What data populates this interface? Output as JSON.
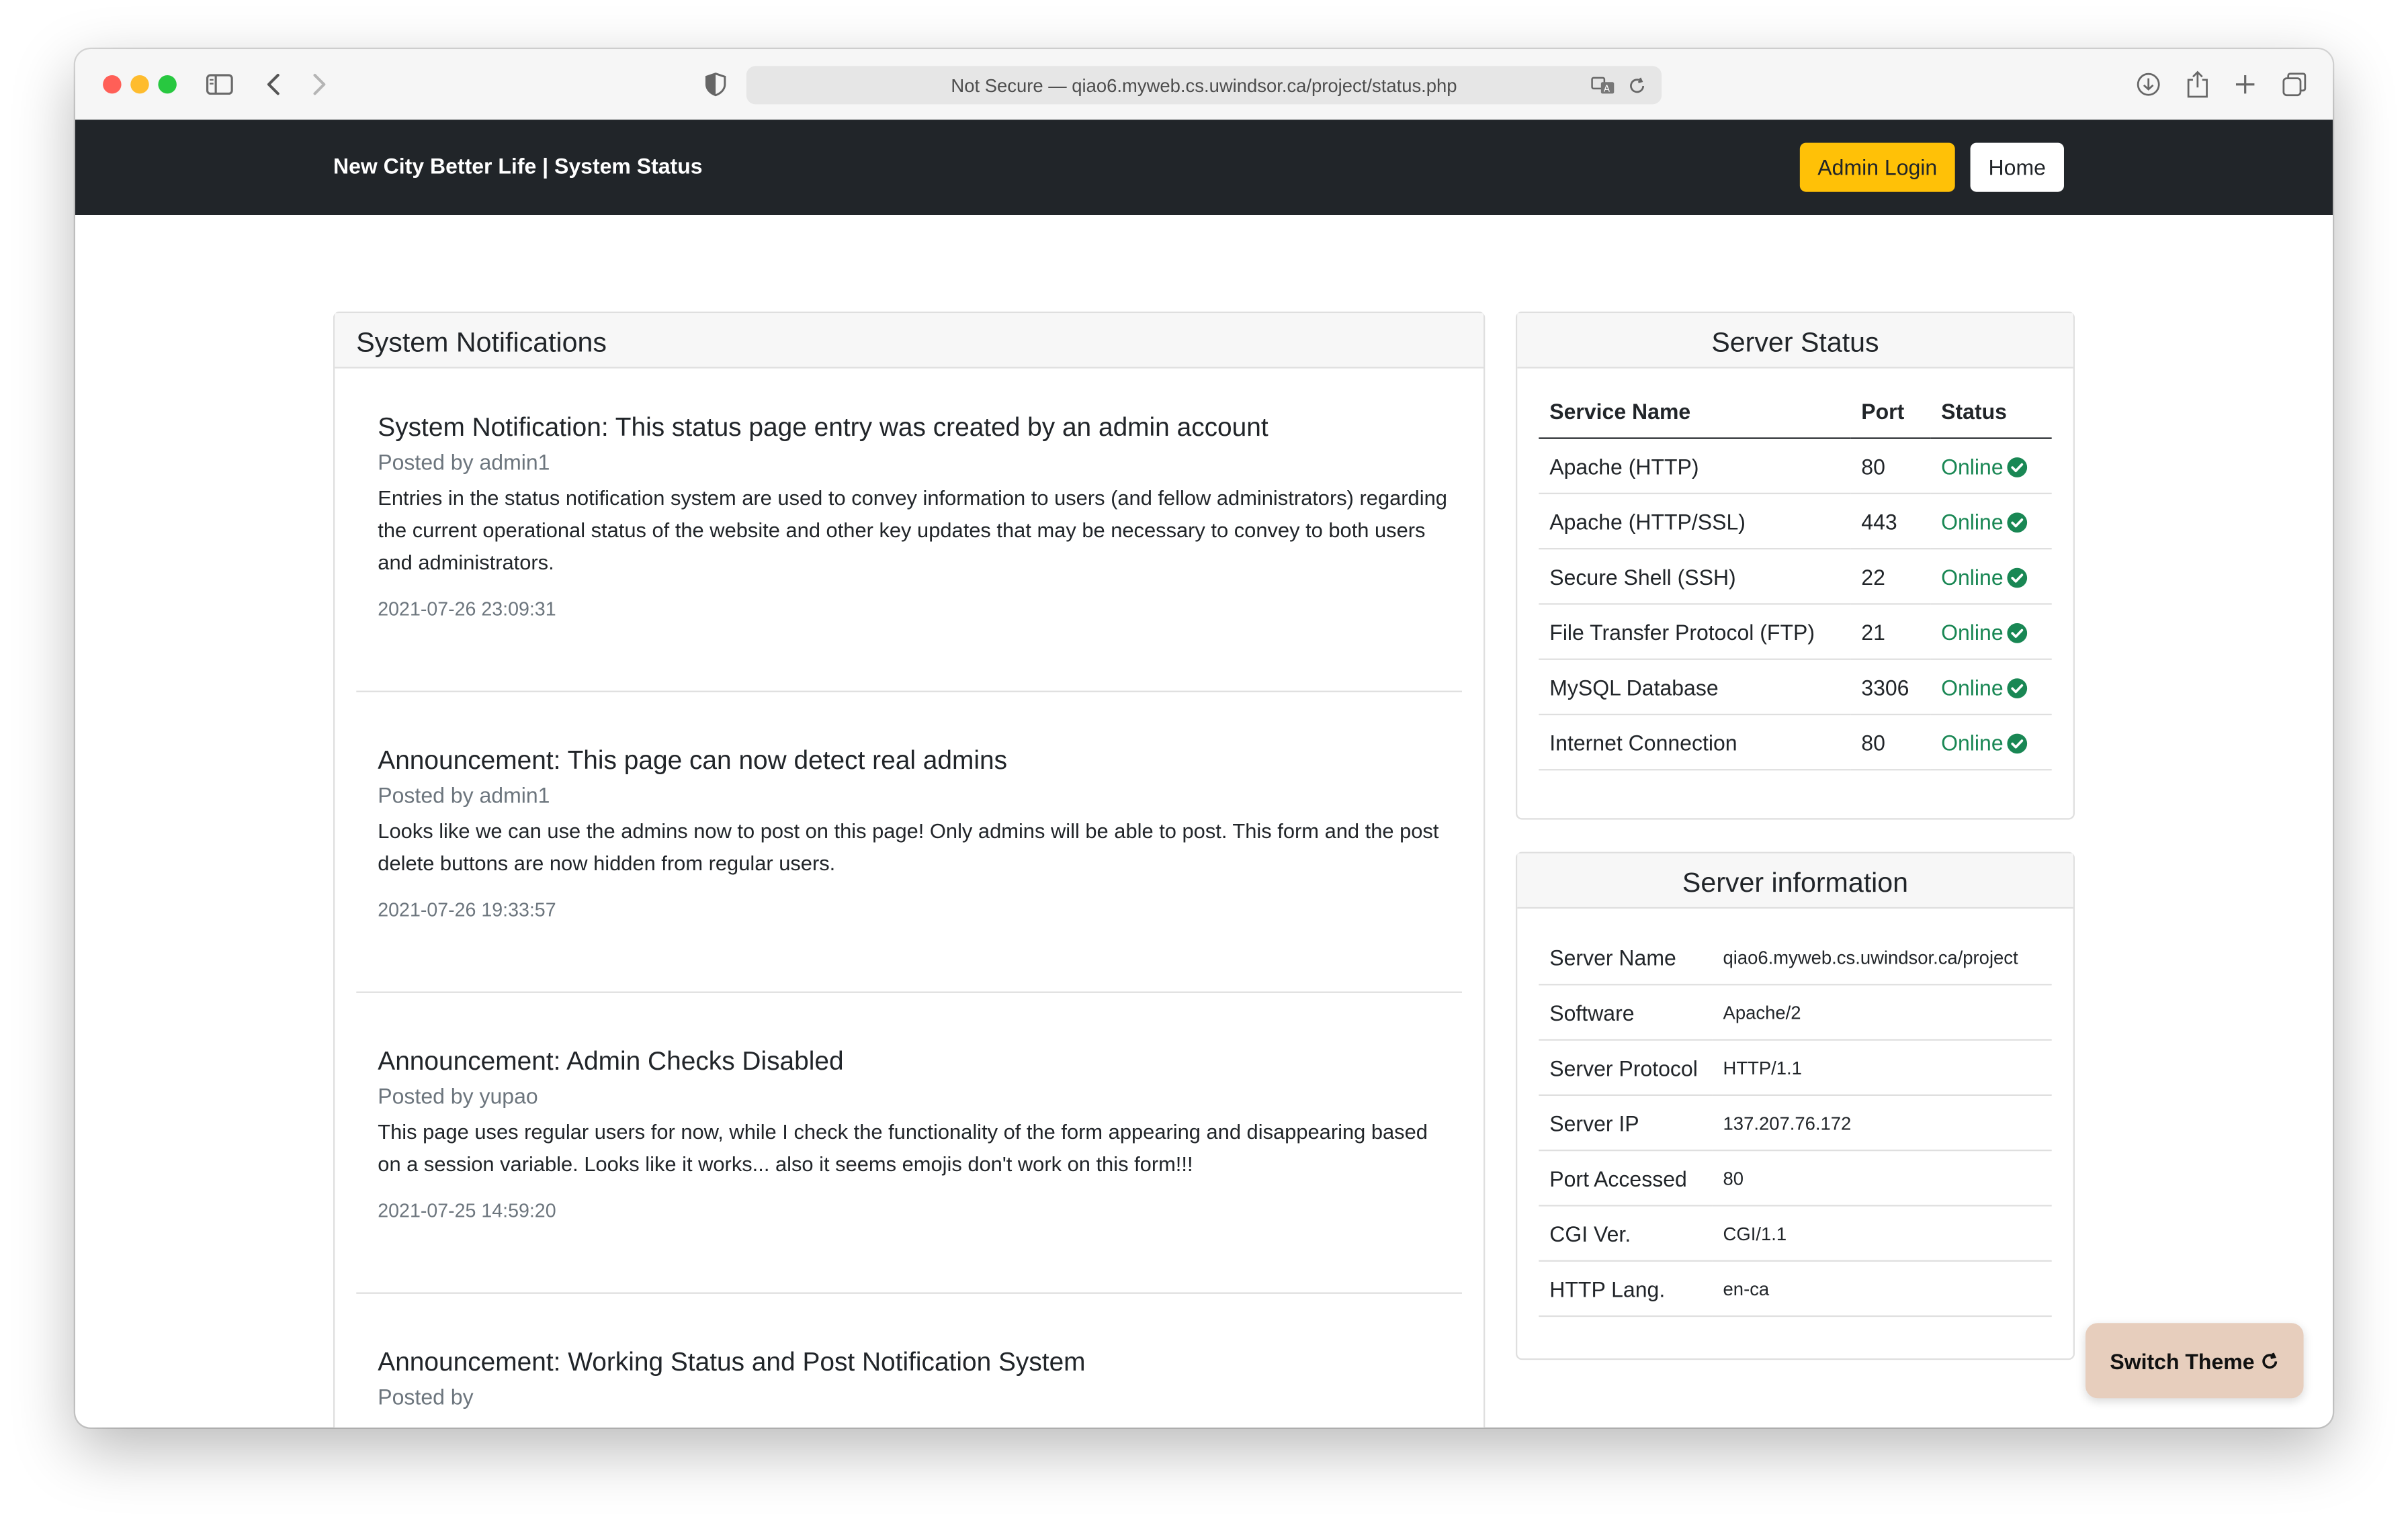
{
  "browser": {
    "address": "Not Secure — qiao6.myweb.cs.uwindsor.ca/project/status.php",
    "traffic_colors": [
      "#ff5f57",
      "#febc2e",
      "#28c840"
    ]
  },
  "navbar": {
    "brand": "New City Better Life | System Status",
    "admin_login": "Admin Login",
    "home": "Home"
  },
  "notifications": {
    "heading": "System Notifications",
    "posts": [
      {
        "title": "System Notification: This status page entry was created by an admin account",
        "posted_by": "Posted by admin1",
        "body": "Entries in the status notification system are used to convey information to users (and fellow administrators) regarding the current operational status of the website and other key updates that may be necessary to convey to both users and administrators.",
        "date": "2021-07-26 23:09:31"
      },
      {
        "title": "Announcement: This page can now detect real admins",
        "posted_by": "Posted by admin1",
        "body": "Looks like we can use the admins now to post on this page! Only admins will be able to post. This form and the post delete buttons are now hidden from regular users.",
        "date": "2021-07-26 19:33:57"
      },
      {
        "title": "Announcement: Admin Checks Disabled",
        "posted_by": "Posted by yupao",
        "body": "This page uses regular users for now, while I check the functionality of the form appearing and disappearing based on a session variable. Looks like it works... also it seems emojis don't work on this form!!!",
        "date": "2021-07-25 14:59:20"
      },
      {
        "title": "Announcement: Working Status and Post Notification System",
        "posted_by": "Posted by"
      }
    ]
  },
  "server_status": {
    "heading": "Server Status",
    "columns": [
      "Service Name",
      "Port",
      "Status"
    ],
    "rows": [
      {
        "service": "Apache (HTTP)",
        "port": "80",
        "status": "Online"
      },
      {
        "service": "Apache (HTTP/SSL)",
        "port": "443",
        "status": "Online"
      },
      {
        "service": "Secure Shell (SSH)",
        "port": "22",
        "status": "Online"
      },
      {
        "service": "File Transfer Protocol (FTP)",
        "port": "21",
        "status": "Online"
      },
      {
        "service": "MySQL Database",
        "port": "3306",
        "status": "Online"
      },
      {
        "service": "Internet Connection",
        "port": "80",
        "status": "Online"
      }
    ]
  },
  "server_info": {
    "heading": "Server information",
    "rows": [
      {
        "key": "Server Name",
        "value": "qiao6.myweb.cs.uwindsor.ca/project"
      },
      {
        "key": "Software",
        "value": "Apache/2"
      },
      {
        "key": "Server Protocol",
        "value": "HTTP/1.1"
      },
      {
        "key": "Server IP",
        "value": "137.207.76.172"
      },
      {
        "key": "Port Accessed",
        "value": "80"
      },
      {
        "key": "CGI Ver.",
        "value": "CGI/1.1"
      },
      {
        "key": "HTTP Lang.",
        "value": "en-ca"
      }
    ]
  },
  "theme_button": "Switch Theme",
  "colors": {
    "navbar": "#212529",
    "admin_button": "#ffc107",
    "online": "#198754",
    "theme_button": "#e7cebd"
  }
}
